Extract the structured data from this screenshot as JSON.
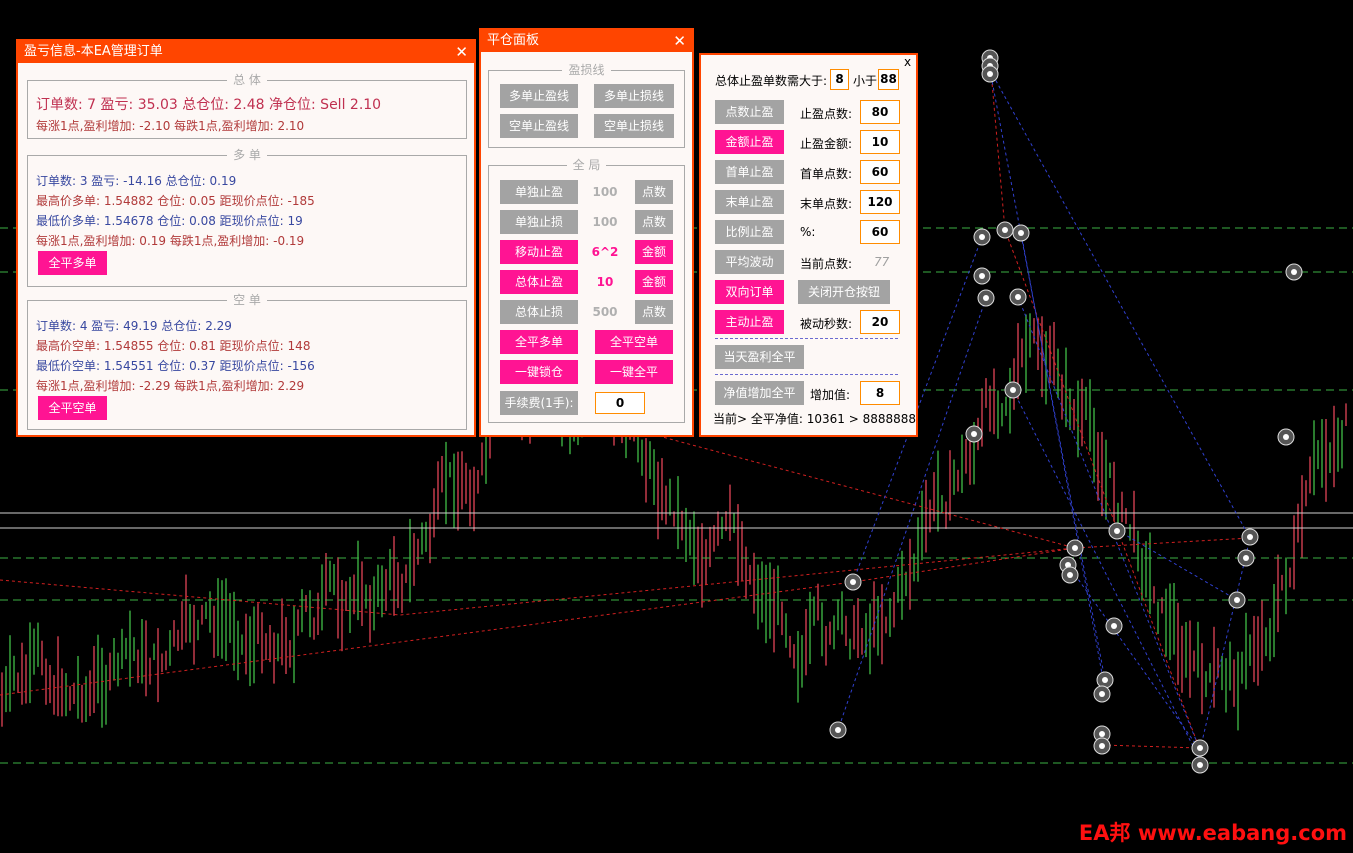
{
  "panel1": {
    "title": "盈亏信息-本EA管理订单",
    "close": "✕",
    "total": {
      "legend": "总 体",
      "line1": "订单数: 7  盈亏: 35.03  总仓位: 2.48  净仓位: Sell 2.10",
      "line2": "每涨1点,盈利增加: -2.10    每跌1点,盈利增加: 2.10"
    },
    "buy": {
      "legend": "多 单",
      "line1": "订单数: 3  盈亏: -14.16  总仓位: 0.19",
      "line2": "最高价多单: 1.54882  仓位: 0.05  距现价点位: -185",
      "line3": "最低价多单: 1.54678  仓位: 0.08  距现价点位: 19",
      "line4": "每涨1点,盈利增加: 0.19    每跌1点,盈利增加: -0.19",
      "close_btn": "全平多单"
    },
    "sell": {
      "legend": "空 单",
      "line1": "订单数: 4  盈亏: 49.19  总仓位: 2.29",
      "line2": "最高价空单: 1.54855  仓位: 0.81  距现价点位: 148",
      "line3": "最低价空单: 1.54551  仓位: 0.37  距现价点位: -156",
      "line4": "每涨1点,盈利增加: -2.29    每跌1点,盈利增加: 2.29",
      "close_btn": "全平空单"
    }
  },
  "panel2": {
    "title": "平仓面板",
    "close": "✕",
    "lines_group": {
      "legend": "盈损线",
      "buy_tp": "多单止盈线",
      "buy_sl": "多单止损线",
      "sell_tp": "空单止盈线",
      "sell_sl": "空单止损线"
    },
    "global_group": {
      "legend": "全 局",
      "rows": [
        {
          "label": "单独止盈",
          "value": "100",
          "unit": "点数"
        },
        {
          "label": "单独止损",
          "value": "100",
          "unit": "点数"
        },
        {
          "label": "移动止盈",
          "value": "6^2",
          "unit": "金额"
        },
        {
          "label": "总体止盈",
          "value": "10",
          "unit": "金额"
        },
        {
          "label": "总体止损",
          "value": "500",
          "unit": "点数"
        }
      ],
      "close_buy": "全平多单",
      "close_sell": "全平空单",
      "lock": "一键锁仓",
      "close_all": "一键全平",
      "lots_label": "手续费(1手):",
      "lots_value": "0"
    }
  },
  "panel3": {
    "close": "x",
    "header_label": "总体止盈单数需大于:",
    "header_min": "8",
    "header_mid": "小于",
    "header_max": "88",
    "rows": [
      {
        "btn": "点数止盈",
        "label": "止盈点数:",
        "value": "80"
      },
      {
        "btn": "金额止盈",
        "label": "止盈金额:",
        "value": "10"
      },
      {
        "btn": "首单止盈",
        "label": "首单点数:",
        "value": "60"
      },
      {
        "btn": "末单止盈",
        "label": "末单点数:",
        "value": "120"
      },
      {
        "btn": "比例止盈",
        "label": "%:",
        "value": "60"
      }
    ],
    "avg_btn": "平均波动",
    "cur_label": "当前点数:",
    "cur_value": "77",
    "bidir_btn": "双向订单",
    "close_open_btn": "关闭开仓按钮",
    "active_btn": "主动止盈",
    "passive_label": "被动秒数:",
    "passive_value": "20",
    "today_btn": "当天盈利全平",
    "equity_btn": "净值增加全平",
    "inc_label": "增加值:",
    "inc_value": "8",
    "footer": "当前> 全平净值: 10361 > 8888888888"
  },
  "watermark": "EA邦 www.eabang.com",
  "colors": {
    "accent": "#ff4500",
    "pink": "#ff1493",
    "gray_button": "#a3a3a3",
    "bull_candle": "#3cb043",
    "bear_candle": "#d24050",
    "guide_line": "#3cb043"
  }
}
